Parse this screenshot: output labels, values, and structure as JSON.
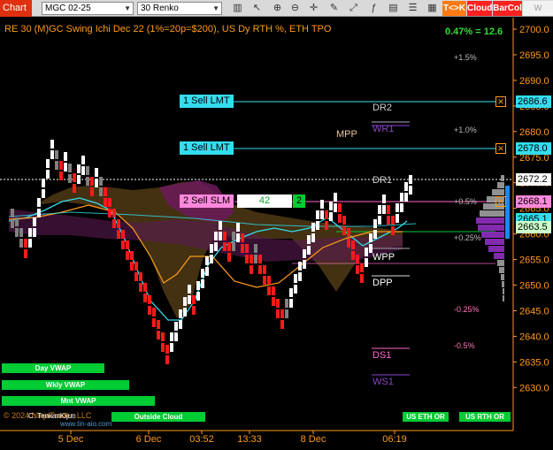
{
  "toolbar": {
    "chart_tab": "Chart",
    "instrument": "MGC 02-25",
    "bar_type": "30 Renko",
    "btn_tk": "T<>K",
    "btn_cloud": "Cloud",
    "btn_barcol": "BarCol",
    "btn_last": "W VWAP"
  },
  "chart_title": "RE 30 (M)GC Swing Ichi Dec 22 (1%=20p=$200), US Dy RTH %, ETH TPO",
  "pct_readout": "0.47% = 12.6",
  "orders": [
    {
      "label": "1 Sell LMT",
      "price": "2686.6"
    },
    {
      "label": "1 Sell LMT",
      "price": "2678.0"
    }
  ],
  "sell_slm": {
    "label": "2 Sell SLM",
    "qty": "42",
    "count": "2",
    "price": "2668.1"
  },
  "price_tags": {
    "last": "2672.2",
    "p2": "2665.1",
    "p3": "2663.5"
  },
  "levels": {
    "dr2": "DR2",
    "wr1": "WR1",
    "mpp": "MPP",
    "dr1": "DR1",
    "wpp": "WPP",
    "dpp": "DPP",
    "ds1": "DS1",
    "ws1": "WS1"
  },
  "pct_levels": {
    "p15": "+1.5%",
    "p10": "+1.0%",
    "p05": "+0.5%",
    "p025": "+0.25%",
    "m025": "-0.25%",
    "m05": "-0.5%"
  },
  "session_buttons": {
    "day_vwap": "Day VWAP",
    "wkly_vwap": "Wkly VWAP",
    "mnt_vwap": "Mnt VWAP",
    "outside_cloud": "Outside Cloud",
    "us_eth_or": "US ETH OR",
    "us_rth_or": "US RTH OR"
  },
  "watermark": "© 2024 NinjaTrader, LLC",
  "watermark2": "www.tin-aio.com",
  "cloud_label": "C: TenkanKijun",
  "y_axis_ticks": [
    "2700.0",
    "2695.0",
    "2690.0",
    "2685.0",
    "2680.0",
    "2675.0",
    "2670.0",
    "2665.0",
    "2660.0",
    "2655.0",
    "2650.0",
    "2645.0",
    "2640.0",
    "2635.0",
    "2630.0"
  ],
  "x_axis_ticks": [
    "5 Dec",
    "6 Dec",
    "03:52",
    "13:33",
    "8 Dec",
    "06:19"
  ],
  "colors": {
    "up_bar": "#ffffff",
    "down_bar": "#ff1a1a",
    "neutral_bar": "#808080",
    "accent_orange": "#ff9a1a",
    "cyan": "#33ddee",
    "vwap_green": "#00cc33",
    "magenta": "#ff66cc",
    "purple": "#8844cc"
  }
}
